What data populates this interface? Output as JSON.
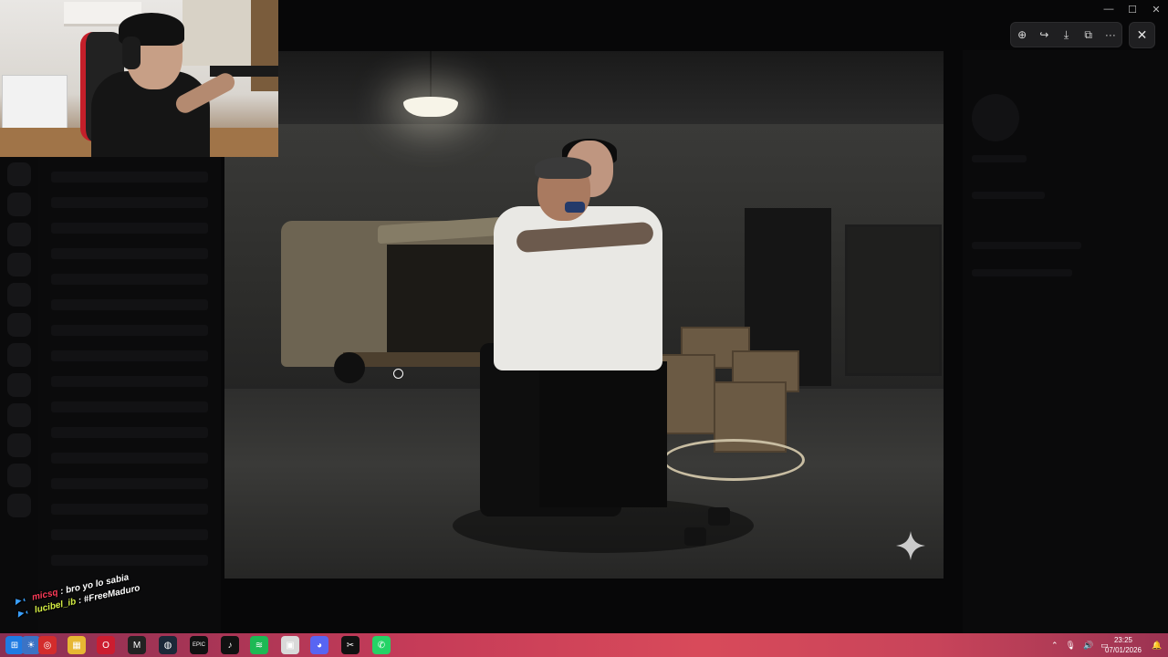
{
  "background_app": {
    "title": "",
    "right_panel": {
      "username": "",
      "lines": [
        "",
        "",
        "",
        ""
      ]
    }
  },
  "viewer": {
    "toolbar": {
      "zoom_icon": "zoom-in-icon",
      "share_icon": "forward-icon",
      "download_icon": "download-icon",
      "open_icon": "open-external-icon",
      "more_icon": "more-icon",
      "zoom_glyph": "⊕",
      "share_glyph": "↪",
      "download_glyph": "⤓",
      "open_glyph": "⧉",
      "more_glyph": "···"
    },
    "close_glyph": "✕"
  },
  "window_controls": {
    "minimize": "—",
    "maximize": "☐",
    "close": "✕"
  },
  "stream_chat": [
    {
      "user": "micsq",
      "message": "bro yo lo sabia",
      "color": "#ff3c5a"
    },
    {
      "user": "lucibel_ib",
      "message": "#FreeMaduro",
      "color": "#d6f045"
    }
  ],
  "chat_separator": ":",
  "chat_badge": "▶ ◐",
  "taskbar": {
    "apps": [
      {
        "name": "start",
        "glyph": "⊞",
        "color": "#1f7be3"
      },
      {
        "name": "widgets",
        "glyph": "☀",
        "color": "#3b73c5"
      },
      {
        "name": "browser",
        "glyph": "◎",
        "color": "#d32c2c"
      },
      {
        "name": "files",
        "glyph": "▦",
        "color": "#e7b733"
      },
      {
        "name": "opera",
        "glyph": "O",
        "color": "#cc1d30"
      },
      {
        "name": "app-m",
        "glyph": "M",
        "color": "#222222"
      },
      {
        "name": "steam",
        "glyph": "◍",
        "color": "#1b2838"
      },
      {
        "name": "epic",
        "glyph": "EPIC",
        "color": "#111111"
      },
      {
        "name": "tiktok",
        "glyph": "♪",
        "color": "#111111"
      },
      {
        "name": "spotify",
        "glyph": "≋",
        "color": "#1db954"
      },
      {
        "name": "photos",
        "glyph": "▣",
        "color": "#d9d9d9"
      },
      {
        "name": "discord",
        "glyph": "◕",
        "color": "#5865f2"
      },
      {
        "name": "capcut",
        "glyph": "✂",
        "color": "#111111"
      },
      {
        "name": "whatsapp",
        "glyph": "✆",
        "color": "#25d366"
      }
    ],
    "time": "23:25",
    "date": "07/01/2026"
  },
  "colors": {
    "accent": "#1f1f21",
    "taskbar_start": "#8a2f53",
    "taskbar_mid": "#d84a5a"
  }
}
